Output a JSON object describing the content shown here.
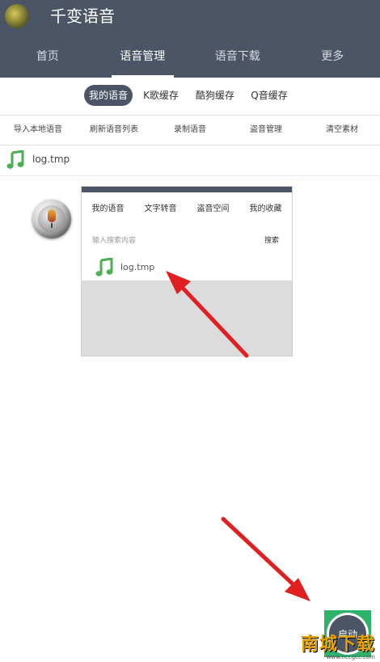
{
  "header": {
    "title": "千变语音",
    "tabs": [
      {
        "label": "首页"
      },
      {
        "label": "语音管理"
      },
      {
        "label": "语音下载"
      },
      {
        "label": "更多"
      }
    ]
  },
  "subtabs": [
    {
      "label": "我的语音"
    },
    {
      "label": "K歌缓存"
    },
    {
      "label": "酷狗缓存"
    },
    {
      "label": "Q音缓存"
    }
  ],
  "actions": [
    {
      "label": "导入本地语音"
    },
    {
      "label": "刷新语音列表"
    },
    {
      "label": "录制语音"
    },
    {
      "label": "盗音管理"
    },
    {
      "label": "清空素材"
    }
  ],
  "file": {
    "name": "log.tmp"
  },
  "inset": {
    "tabs": [
      {
        "label": "我的语音"
      },
      {
        "label": "文字转音"
      },
      {
        "label": "盗音空间"
      },
      {
        "label": "我的收藏"
      }
    ],
    "search_placeholder": "输入搜索内容",
    "search_button": "搜索",
    "file_name": "log.tmp"
  },
  "fab": {
    "label": "启动"
  },
  "watermark": {
    "main": "南城下载",
    "sub": "www.nccgcc.com"
  },
  "colors": {
    "header": "#4b5566",
    "music": "#4caf50",
    "arrow": "#e02020"
  }
}
